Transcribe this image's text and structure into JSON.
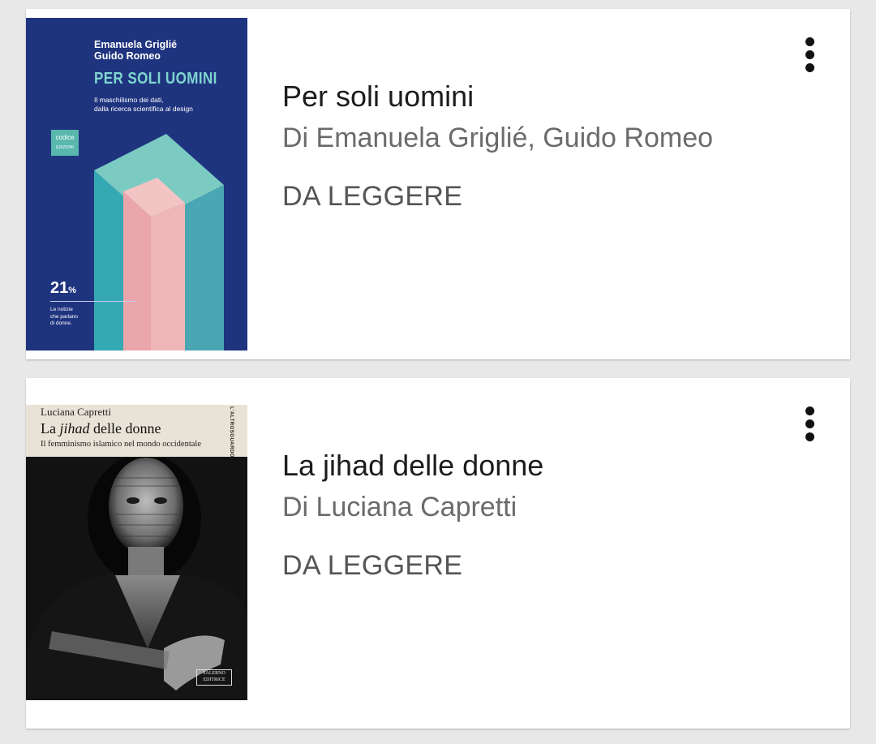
{
  "books": [
    {
      "title": "Per soli uomini",
      "author": "Di Emanuela Griglié, Guido Romeo",
      "status": "DA LEGGERE",
      "cover": {
        "authors_line1": "Emanuela Griglié",
        "authors_line2": "Guido Romeo",
        "title": "PER SOLI UOMINI",
        "subtitle_line1": "Il maschilismo dei dati,",
        "subtitle_line2": "dalla ricerca scientifica al design",
        "publisher_line1": "codice",
        "publisher_line2": "EDIZIONI",
        "stat_number": "21",
        "stat_unit": "%",
        "note_line1": "Le notizie",
        "note_line2": "che parlano",
        "note_line3": "di donne.",
        "colors": {
          "background": "#1f347f",
          "accent": "#7fd6d0",
          "pink": "#eeb4b8"
        }
      }
    },
    {
      "title": "La jihad delle donne",
      "author": "Di Luciana Capretti",
      "status": "DA LEGGERE",
      "cover": {
        "author": "Luciana Capretti",
        "title_prefix": "La ",
        "title_italic": "jihad",
        "title_suffix": " delle donne",
        "subtitle": "Il femminismo islamico nel mondo occidentale",
        "series": "L'ALTROSGUARDO",
        "publisher_line1": "SALERNO",
        "publisher_line2": "EDITRICE"
      }
    }
  ],
  "menu_icon": "more-vert-icon"
}
